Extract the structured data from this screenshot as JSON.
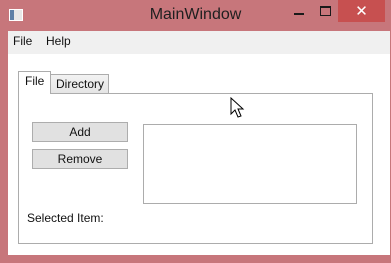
{
  "window": {
    "title": "MainWindow",
    "minimize_glyph": "—",
    "maximize_glyph": "□",
    "close_glyph": "✕"
  },
  "menu": {
    "items": [
      "File",
      "Help"
    ]
  },
  "tabs": {
    "items": [
      "File",
      "Directory"
    ],
    "selected": "File"
  },
  "panel": {
    "add_button": "Add",
    "remove_button": "Remove",
    "selected_item_label": "Selected Item:",
    "list_items": []
  },
  "colors": {
    "window_frame": "#c7767b",
    "close_button": "#c75050",
    "menubar": "#f0f0f0",
    "button_face": "#e1e1e1",
    "border": "#acacac"
  },
  "icons": {
    "app": "window-icon",
    "cursor": "mouse-pointer-icon"
  }
}
